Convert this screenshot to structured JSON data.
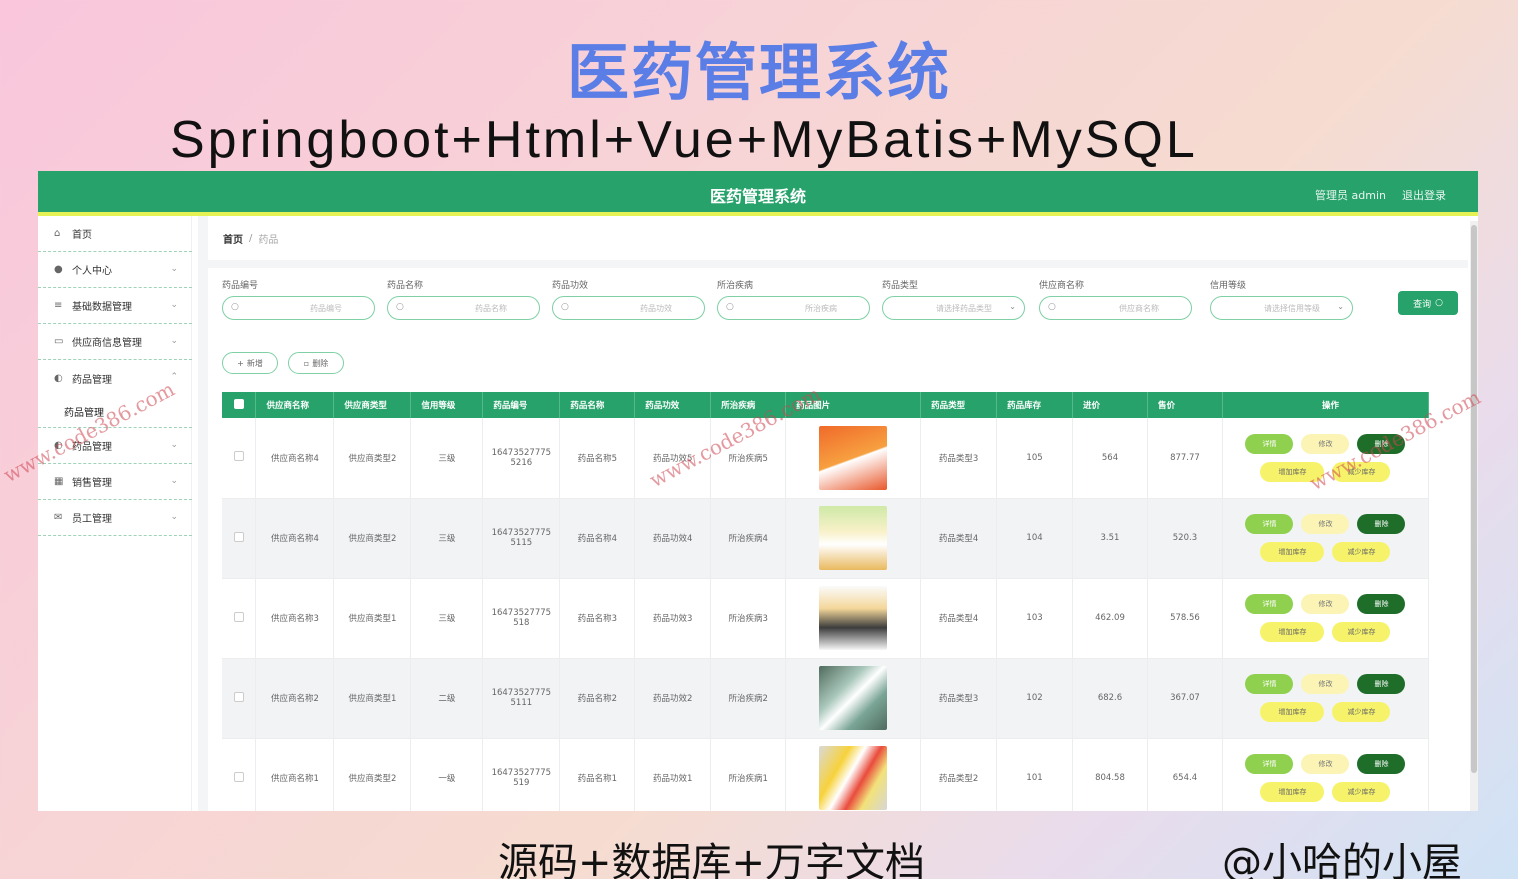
{
  "poster": {
    "title": "医药管理系统",
    "subtitle": "Springboot+Html+Vue+MyBatis+MySQL",
    "bottom_left": "源码+数据库+万字文档",
    "bottom_right": "@小哈的小屋",
    "watermark": "www.code386.com"
  },
  "header": {
    "title": "医药管理系统",
    "user": "管理员 admin",
    "logout": "退出登录",
    "accent": "#26a26a",
    "accent_bar": "#e6f254"
  },
  "sidebar": {
    "items": [
      {
        "label": "首页",
        "icon": "home-icon"
      },
      {
        "label": "个人中心",
        "icon": "user-icon"
      },
      {
        "label": "基础数据管理",
        "icon": "list-icon"
      },
      {
        "label": "供应商信息管理",
        "icon": "card-icon"
      },
      {
        "label": "药品管理",
        "icon": "pin-icon",
        "sub": "药品管理"
      },
      {
        "label": "药品管理",
        "icon": "pin-icon"
      },
      {
        "label": "销售管理",
        "icon": "grid-icon"
      },
      {
        "label": "员工管理",
        "icon": "mail-icon"
      }
    ]
  },
  "breadcrumb": {
    "home": "首页",
    "current": "药品"
  },
  "filters": [
    {
      "label": "药品编号",
      "placeholder": "药品编号"
    },
    {
      "label": "药品名称",
      "placeholder": "药品名称"
    },
    {
      "label": "药品功效",
      "placeholder": "药品功效"
    },
    {
      "label": "所治疾病",
      "placeholder": "所治疾病"
    },
    {
      "label": "药品类型",
      "placeholder": "请选择药品类型"
    },
    {
      "label": "供应商名称",
      "placeholder": "供应商名称"
    },
    {
      "label": "信用等级",
      "placeholder": "请选择信用等级"
    }
  ],
  "buttons": {
    "query": "查询",
    "add": "新增",
    "delete": "删除"
  },
  "table": {
    "headers": [
      "供应商名称",
      "供应商类型",
      "信用等级",
      "药品编号",
      "药品名称",
      "药品功效",
      "所治疾病",
      "药品图片",
      "药品类型",
      "药品库存",
      "进价",
      "售价",
      "操作"
    ],
    "rows": [
      {
        "supplier": "供应商名称4",
        "stype": "供应商类型2",
        "credit": "三级",
        "code": "16473527775 5216",
        "name": "药品名称5",
        "effect": "药品功效5",
        "disease": "所治疾病5",
        "type": "药品类型3",
        "stock": "105",
        "cost": "564",
        "price": "877.77"
      },
      {
        "supplier": "供应商名称4",
        "stype": "供应商类型2",
        "credit": "三级",
        "code": "16473527775 5115",
        "name": "药品名称4",
        "effect": "药品功效4",
        "disease": "所治疾病4",
        "type": "药品类型4",
        "stock": "104",
        "cost": "3.51",
        "price": "520.3"
      },
      {
        "supplier": "供应商名称3",
        "stype": "供应商类型1",
        "credit": "三级",
        "code": "16473527775 518",
        "name": "药品名称3",
        "effect": "药品功效3",
        "disease": "所治疾病3",
        "type": "药品类型4",
        "stock": "103",
        "cost": "462.09",
        "price": "578.56"
      },
      {
        "supplier": "供应商名称2",
        "stype": "供应商类型1",
        "credit": "二级",
        "code": "16473527775 5111",
        "name": "药品名称2",
        "effect": "药品功效2",
        "disease": "所治疾病2",
        "type": "药品类型3",
        "stock": "102",
        "cost": "682.6",
        "price": "367.07"
      },
      {
        "supplier": "供应商名称1",
        "stype": "供应商类型2",
        "credit": "一级",
        "code": "16473527775 519",
        "name": "药品名称1",
        "effect": "药品功效1",
        "disease": "所治疾病1",
        "type": "药品类型2",
        "stock": "101",
        "cost": "804.58",
        "price": "654.4"
      }
    ],
    "ops": {
      "detail": "详情",
      "edit": "修改",
      "delete": "删除",
      "add_stock": "增加库存",
      "sub_stock": "减少库存"
    }
  }
}
